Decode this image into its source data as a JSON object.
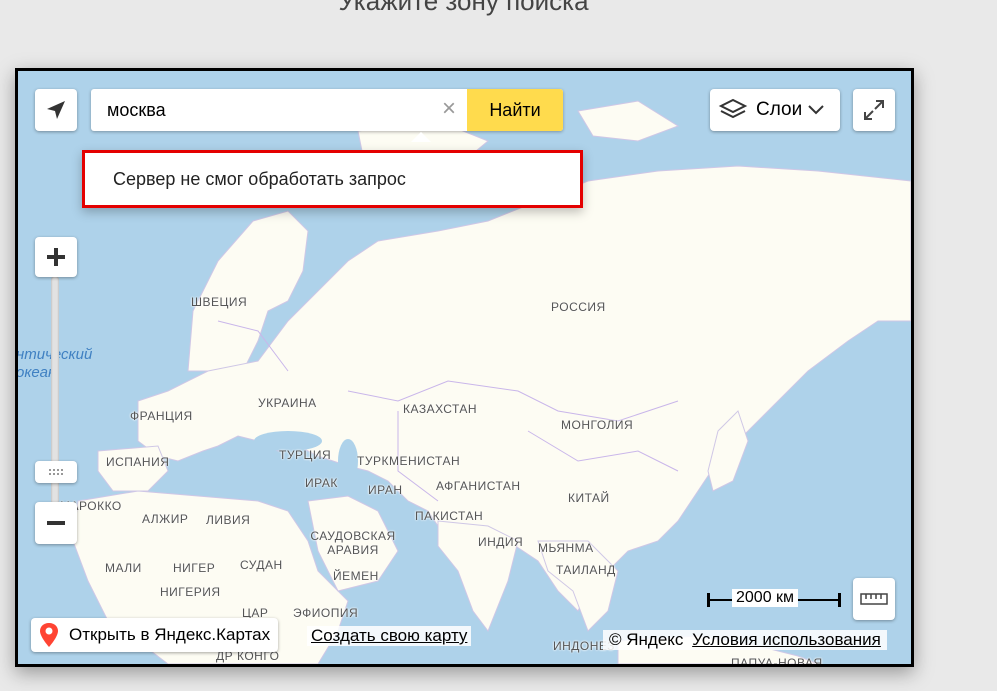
{
  "page": {
    "heading": "Укажите зону поиска"
  },
  "search": {
    "value": "москва",
    "clear_symbol": "×",
    "button_label": "Найти"
  },
  "error": {
    "message": "Сервер не смог обработать запрос"
  },
  "layers": {
    "label": "Слои"
  },
  "map_labels": {
    "russia": "РОССИЯ",
    "sweden": "ШВЕЦИЯ",
    "ukraine": "УКРАИНА",
    "france": "ФРАНЦИЯ",
    "spain": "ИСПАНИЯ",
    "turkey": "ТУРЦИЯ",
    "kazakhstan": "КАЗАХСТАН",
    "mongolia": "МОНГОЛИЯ",
    "turkmenistan": "ТУРКМЕНИСТАН",
    "iraq": "ИРАК",
    "iran": "ИРАН",
    "afghanistan": "АФГАНИСТАН",
    "china": "КИТАЙ",
    "morocco": "МАРОККО",
    "algeria": "АЛЖИР",
    "libya": "ЛИВИЯ",
    "pakistan": "ПАКИСТАН",
    "saudi_arabia": "САУДОВСКАЯ АРАВИЯ",
    "india": "ИНДИЯ",
    "myanmar": "МЬЯНМА",
    "mali": "МАЛИ",
    "niger": "НИГЕР",
    "sudan": "СУДАН",
    "yemen": "ЙЕМЕН",
    "thailand": "ТАИЛАНД",
    "nigeria": "НИГЕРИЯ",
    "car": "ЦАР",
    "ethiopia": "ЭФИОПИЯ",
    "dr_congo": "ДР КОНГО",
    "indonesia": "ИНДОНЕЗ",
    "papua": "ПАПУА-НОВАЯ",
    "atlantic_line1": "нтический",
    "atlantic_line2": "океан"
  },
  "scale": {
    "label": "2000 км"
  },
  "footer": {
    "open_label": "Открыть в Яндекс.Картах",
    "create_label": "Создать свою карту",
    "copyright": "© Яндекс",
    "terms": "Условия использования"
  },
  "colors": {
    "water": "#aed2ea",
    "land": "#fdfcf3",
    "accent_yellow": "#ffdb4d",
    "error_border": "#e40000",
    "pin_red": "#f43"
  }
}
